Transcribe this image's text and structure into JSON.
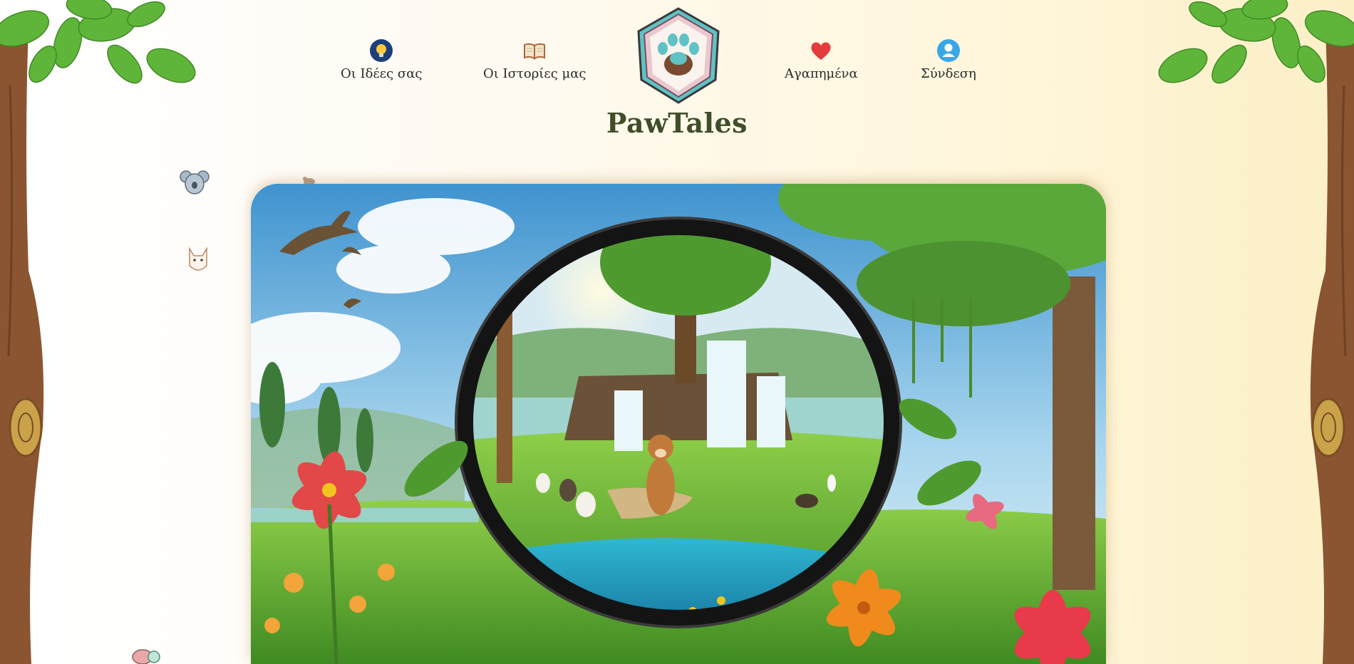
{
  "site": {
    "brand_name": "PawTales"
  },
  "nav": {
    "items": [
      {
        "label": "Οι Ιδέες σας",
        "icon": "lightbulb-icon"
      },
      {
        "label": "Οι Ιστορίες μας",
        "icon": "open-book-icon"
      },
      {
        "label": "Αγαπημένα",
        "icon": "heart-icon"
      },
      {
        "label": "Σύνδεση",
        "icon": "user-icon"
      }
    ]
  },
  "logo": {
    "icon": "paw-print-icon"
  },
  "hero": {
    "description_icon": "forest-portal-illustration"
  },
  "colors": {
    "brand_text": "#3f4e29",
    "nav_text": "#2a2a2a",
    "background_left": "#ffffff",
    "background_right": "#fbefc6",
    "trunk": "#8a5530",
    "leaf": "#62b83e",
    "heart": "#e23c3c",
    "user_icon": "#39a7e8",
    "lightbulb_bg": "#1c3f7a"
  }
}
